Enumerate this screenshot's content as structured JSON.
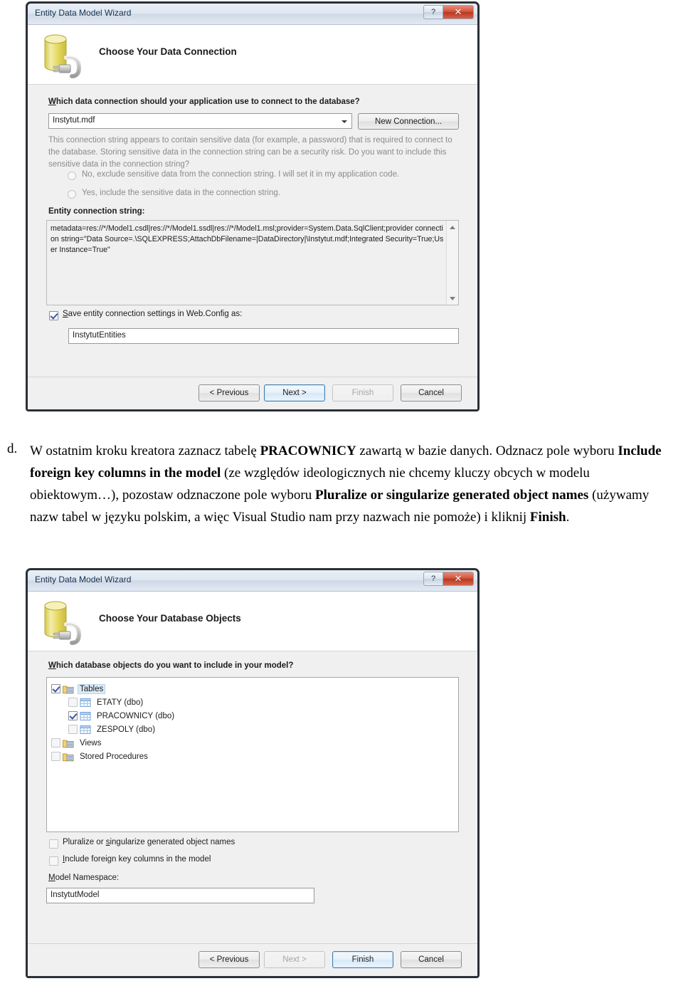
{
  "document": {
    "list_marker": "d.",
    "paragraph_parts": [
      {
        "t": "W ostatnim kroku kreatora zaznacz tabelę ",
        "b": false
      },
      {
        "t": "PRACOWNICY",
        "b": true
      },
      {
        "t": " zawartą w bazie danych. Odznacz pole wyboru ",
        "b": false
      },
      {
        "t": "Include foreign key columns in the model",
        "b": true
      },
      {
        "t": " (ze względów ideologicznych nie chcemy kluczy obcych w modelu obiektowym…), pozostaw odznaczone pole wyboru ",
        "b": false
      },
      {
        "t": "Pluralize or singularize generated object names",
        "b": true
      },
      {
        "t": " (używamy nazw tabel w języku polskim, a więc Visual Studio nam przy nazwach nie pomoże) i kliknij ",
        "b": false
      },
      {
        "t": "Finish",
        "b": true
      },
      {
        "t": ".",
        "b": false
      }
    ]
  },
  "dialog1": {
    "window_title": "Entity Data Model Wizard",
    "help_button": "?",
    "close_button": "✕",
    "header_title": "Choose Your Data Connection",
    "question_label": "Which data connection should your application use to connect to the database?",
    "connection_combo_value": "Instytut.mdf",
    "new_connection_button": "New Connection...",
    "sensitive_note": "This connection string appears to contain sensitive data (for example, a password) that is required to connect to the database. Storing sensitive data in the connection string can be a security risk. Do you want to include this sensitive data in the connection string?",
    "radio_no_label": "No, exclude sensitive data from the connection string. I will set it in my application code.",
    "radio_yes_label": "Yes, include the sensitive data in the connection string.",
    "entity_connection_string_label": "Entity connection string:",
    "entity_connection_string_value": "metadata=res://*/Model1.csdl|res://*/Model1.ssdl|res://*/Model1.msl;provider=System.Data.SqlClient;provider connection string=\"Data Source=.\\SQLEXPRESS;AttachDbFilename=|DataDirectory|\\Instytut.mdf;Integrated Security=True;User Instance=True\"",
    "save_settings_checkbox_label": "Save entity connection settings in Web.Config as:",
    "save_settings_checked": true,
    "entities_name_value": "InstytutEntities",
    "buttons": {
      "previous": "< Previous",
      "next": "Next >",
      "finish": "Finish",
      "cancel": "Cancel"
    }
  },
  "dialog2": {
    "window_title": "Entity Data Model Wizard",
    "help_button": "?",
    "close_button": "✕",
    "header_title": "Choose Your Database Objects",
    "question_label": "Which database objects do you want to include in your model?",
    "tree": [
      {
        "label": "Tables",
        "checked": true,
        "indent": 0,
        "icon": "tables-folder-icon",
        "selected": true
      },
      {
        "label": "ETATY (dbo)",
        "checked": false,
        "indent": 1,
        "icon": "table-icon",
        "selected": false
      },
      {
        "label": "PRACOWNICY (dbo)",
        "checked": true,
        "indent": 1,
        "icon": "table-icon",
        "selected": false
      },
      {
        "label": "ZESPOLY (dbo)",
        "checked": false,
        "indent": 1,
        "icon": "table-icon",
        "selected": false
      },
      {
        "label": "Views",
        "checked": false,
        "indent": 0,
        "icon": "views-folder-icon",
        "selected": false
      },
      {
        "label": "Stored Procedures",
        "checked": false,
        "indent": 0,
        "icon": "procedures-folder-icon",
        "selected": false
      }
    ],
    "pluralize_checkbox_label": "Pluralize or singularize generated object names",
    "pluralize_checked": false,
    "foreign_key_checkbox_label": "Include foreign key columns in the model",
    "foreign_key_checked": false,
    "model_namespace_label": "Model Namespace:",
    "model_namespace_value": "InstytutModel",
    "buttons": {
      "previous": "< Previous",
      "next": "Next >",
      "finish": "Finish",
      "cancel": "Cancel"
    }
  },
  "colors": {
    "close_red": "#c0392b",
    "accent_blue": "#3c7fb1",
    "db_yellow": "#e8dd6a"
  }
}
